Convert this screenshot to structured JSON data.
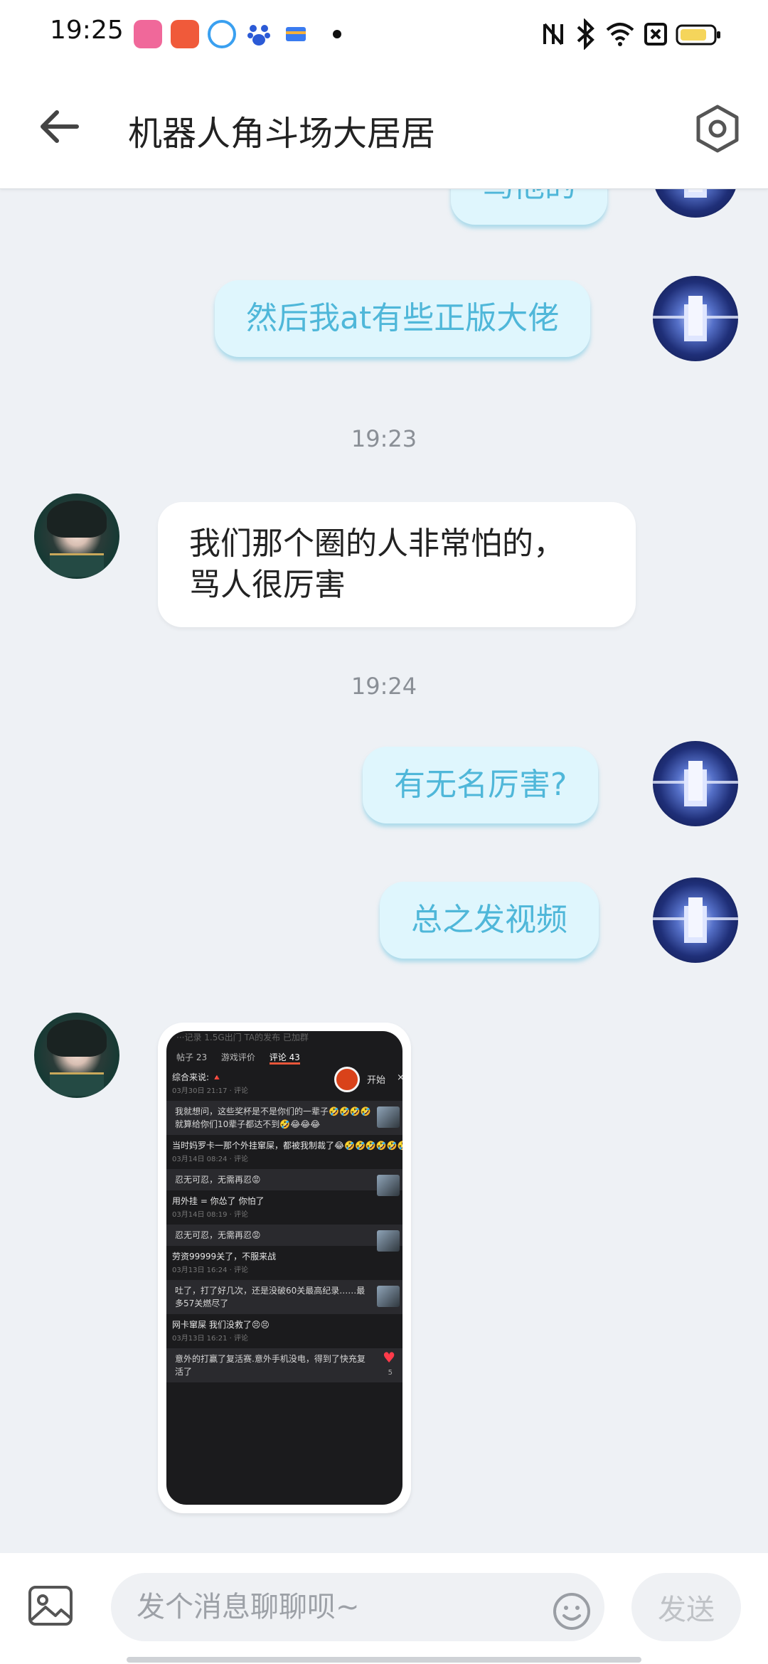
{
  "status_bar": {
    "time": "19:25",
    "apps": [
      "bilibili-icon",
      "video-player-icon",
      "browser-icon",
      "baidu-icon",
      "wallet-icon"
    ],
    "system_icons": [
      "nfc-icon",
      "bluetooth-icon",
      "wifi-icon",
      "no-sim-icon",
      "battery-icon"
    ]
  },
  "header": {
    "title": "机器人角斗场大居居",
    "back_icon": "arrow-left-icon",
    "settings_icon": "hexagon-settings-icon"
  },
  "chat": {
    "messages": [
      {
        "direction": "out",
        "text": "骂他的"
      },
      {
        "direction": "out",
        "text": "然后我at有些正版大佬"
      },
      {
        "type": "timestamp",
        "text": "19:23"
      },
      {
        "direction": "in",
        "text": "我们那个圈的人非常怕的，骂人很厉害",
        "lines": [
          "我们那个圈的人非常怕的，",
          "骂人很厉害"
        ]
      },
      {
        "type": "timestamp",
        "text": "19:24"
      },
      {
        "direction": "out",
        "text": "有无名厉害?"
      },
      {
        "direction": "out",
        "text": "总之发视频"
      },
      {
        "direction": "in",
        "type": "image"
      }
    ],
    "screenshot": {
      "tabs": [
        "帖子 23",
        "游戏评价",
        "评论 43"
      ],
      "top_partial": "···记录    1.5G出门    TA的发布    已加群",
      "start_label": "开始",
      "close": "×",
      "items": [
        {
          "title": "综合来说: 🔺",
          "meta": "03月30日 21:17 · 评论",
          "reply": "我就想问，这些奖杯是不是你们的一辈子🤣🤣🤣🤣就算给你们10辈子都达不到🤣😂😂😂"
        },
        {
          "title": "当时妈罗卡一那个外挂窜屎，都被我制裁了😂🤣🤣🤣🤣🤣🤣🤣🤣🤣🤣🤣🤣🤣🤣🤣🤣🤣🤣🤣🤣🤣🤣",
          "meta": "03月14日 08:24 · 评论",
          "reply": "忍无可忍，无需再忍😡"
        },
        {
          "title": "用外挂 = 你怂了 你怕了",
          "meta": "03月14日 08:19 · 评论",
          "reply": "忍无可忍，无需再忍😡"
        },
        {
          "title": "劳资99999关了，不服来战",
          "meta": "03月13日 16:24 · 评论",
          "reply": "吐了，打了好几次，还是没破60关最高纪录……最多57关燃尽了"
        },
        {
          "title": "网卡窜屎 我们没救了😣😣",
          "meta": "03月13日 16:21 · 评论",
          "reply": "意外的打赢了复活赛.意外手机没电，得到了快充复活了"
        }
      ],
      "heart_count": "5"
    }
  },
  "input_bar": {
    "placeholder": "发个消息聊聊呗~",
    "send_label": "发送",
    "image_icon": "image-icon",
    "emoji_icon": "emoji-icon"
  }
}
